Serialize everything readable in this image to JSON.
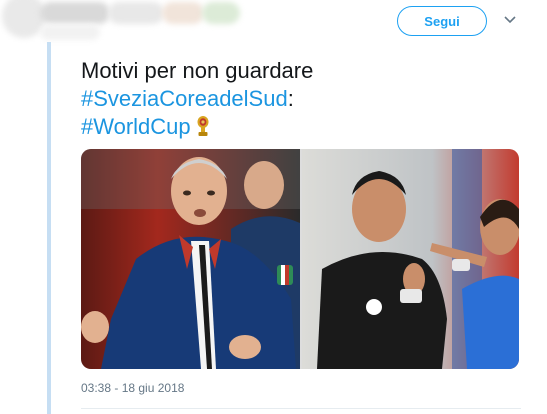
{
  "header": {
    "follow_label": "Segui"
  },
  "tweet": {
    "line1": "Motivi per non guardare",
    "hashtag1": "#SveziaCoreadelSud",
    "line2_suffix": ":",
    "hashtag2": "#WorldCup",
    "timestamp": "03:38 - 18 giu 2018"
  },
  "colors": {
    "link": "#1b95e0",
    "follow": "#1da1f2",
    "thread": "#c6def3"
  },
  "icons": {
    "caret": "chevron-down-icon",
    "emoji": "world-cup-trophy-icon"
  }
}
